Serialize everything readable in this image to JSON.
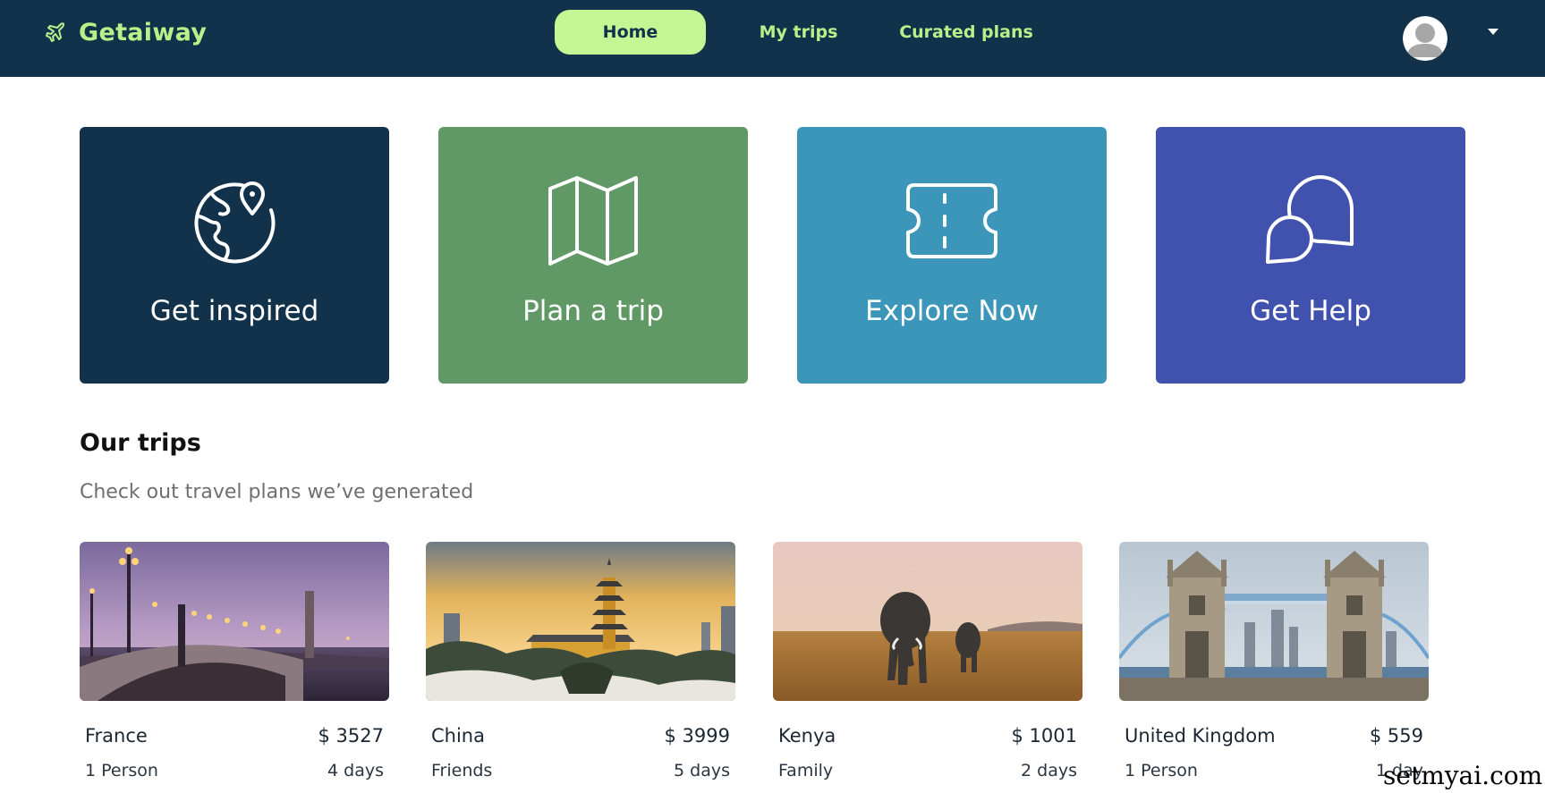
{
  "brand": {
    "name": "Getaiway",
    "color": "#b9f08a"
  },
  "nav": {
    "items": [
      {
        "label": "Home",
        "active": true
      },
      {
        "label": "My trips",
        "active": false
      },
      {
        "label": "Curated plans",
        "active": false
      }
    ],
    "background": "#11324a",
    "active_background": "#c5f693"
  },
  "user": {
    "avatar_icon": "user-avatar-icon",
    "menu_icon": "caret-down-icon"
  },
  "actions": [
    {
      "label": "Get inspired",
      "icon": "globe-pin-icon",
      "color": "#11324a"
    },
    {
      "label": "Plan a trip",
      "icon": "map-icon",
      "color": "#609866"
    },
    {
      "label": "Explore Now",
      "icon": "ticket-icon",
      "color": "#3b96ba"
    },
    {
      "label": "Get Help",
      "icon": "chat-bubbles-icon",
      "color": "#4152ae"
    }
  ],
  "trips_section": {
    "title": "Our trips",
    "subtitle": "Check out travel plans we’ve generated"
  },
  "trips": [
    {
      "name": "France",
      "price": "$ 3527",
      "group": "1 Person",
      "duration": "4 days"
    },
    {
      "name": "China",
      "price": "$ 3999",
      "group": "Friends",
      "duration": "5 days"
    },
    {
      "name": "Kenya",
      "price": "$ 1001",
      "group": "Family",
      "duration": "2 days"
    },
    {
      "name": "United Kingdom",
      "price": "$ 559",
      "group": "1 Person",
      "duration": "1 day"
    }
  ],
  "watermark": "setmyai.com"
}
